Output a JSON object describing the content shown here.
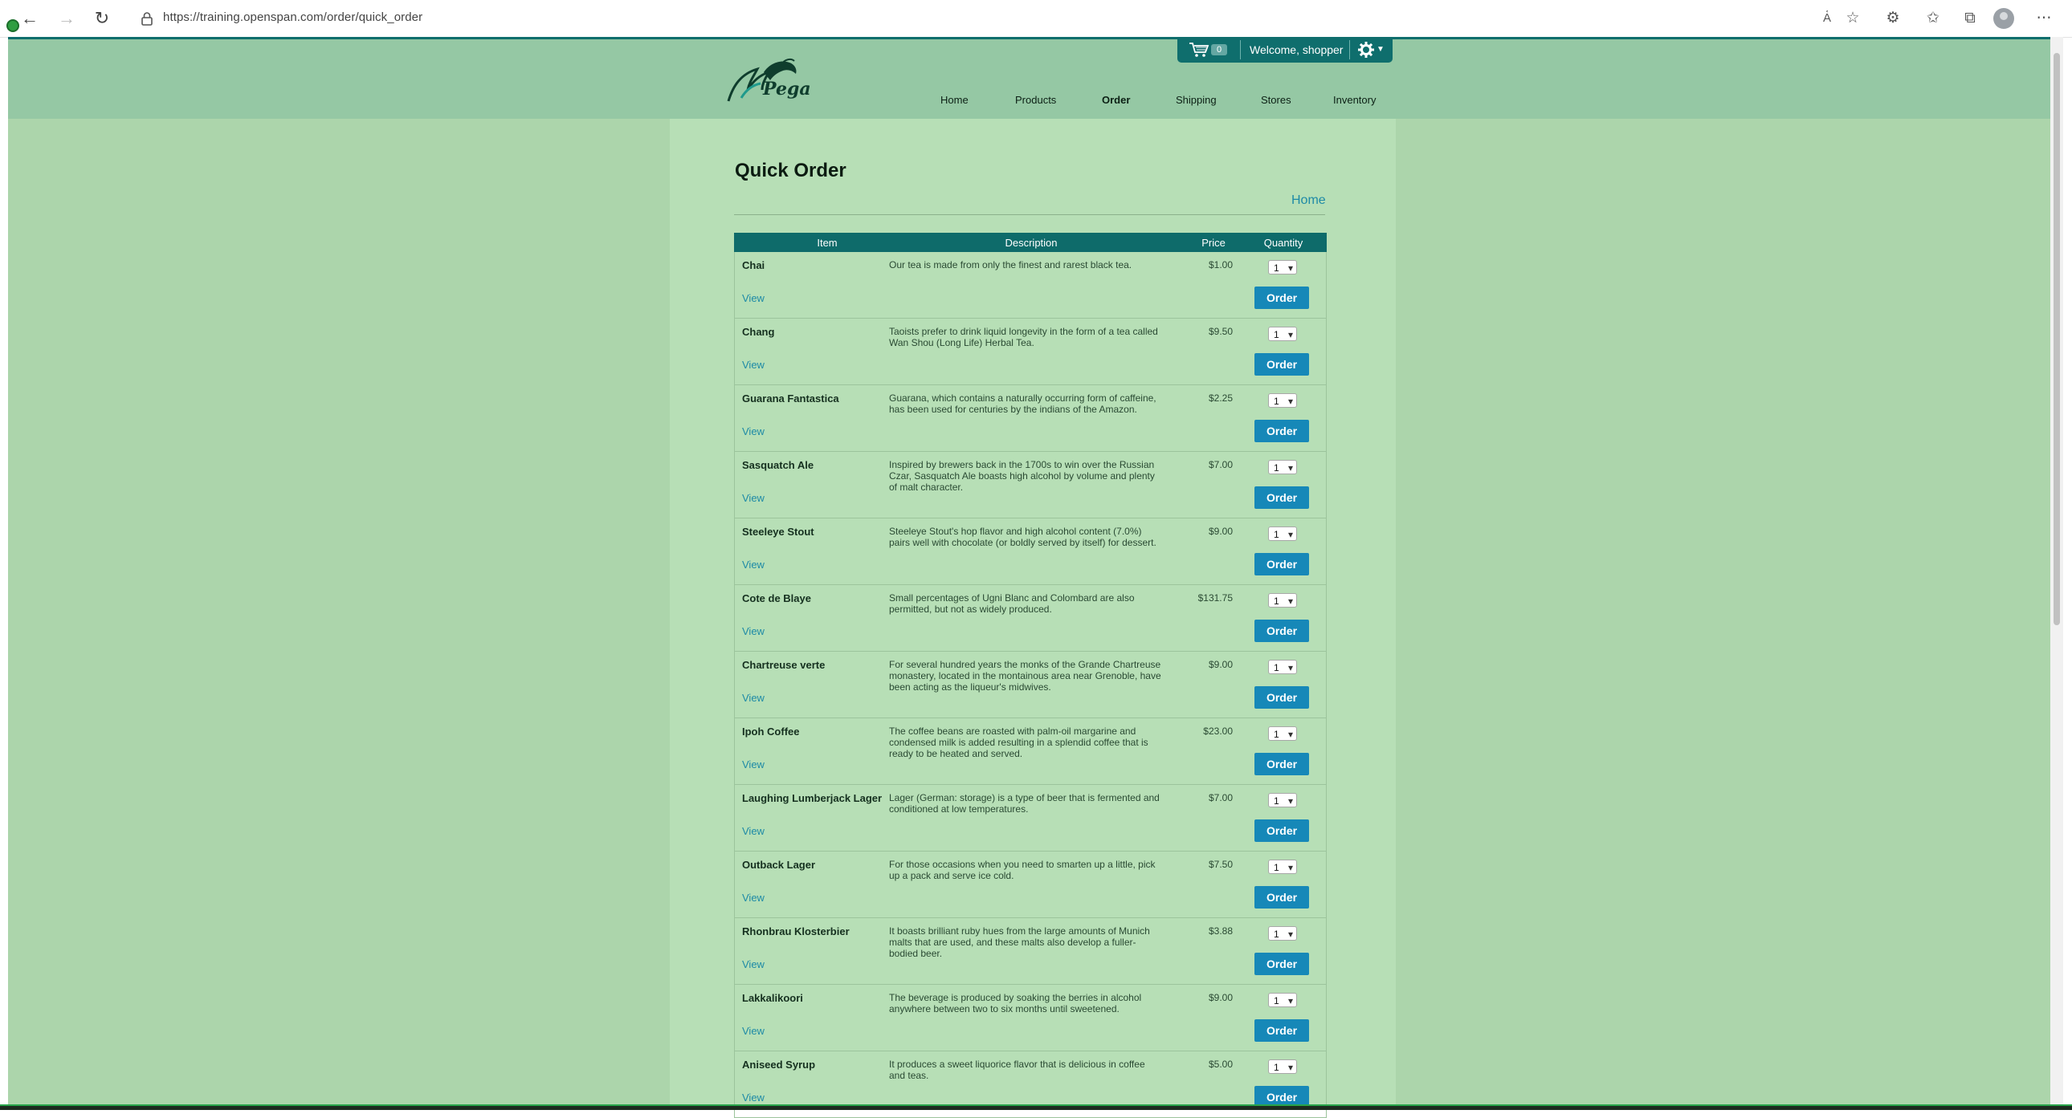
{
  "browser": {
    "url": "https://training.openspan.com/order/quick_order"
  },
  "site": {
    "logo_text": "Pega",
    "cart_count": "0",
    "welcome": "Welcome, shopper",
    "nav": [
      "Home",
      "Products",
      "Order",
      "Shipping",
      "Stores",
      "Inventory"
    ],
    "active_nav": "Order"
  },
  "page": {
    "title": "Quick Order",
    "home_link": "Home"
  },
  "table": {
    "headers": {
      "item": "Item",
      "description": "Description",
      "price": "Price",
      "quantity": "Quantity"
    },
    "view_label": "View",
    "order_label": "Order",
    "rows": [
      {
        "name": "Chai",
        "desc": "Our tea is made from only the finest and rarest black tea.",
        "price": "$1.00",
        "qty": "1"
      },
      {
        "name": "Chang",
        "desc": "Taoists prefer to drink liquid longevity in the form of a tea called Wan Shou (Long Life) Herbal Tea.",
        "price": "$9.50",
        "qty": "1"
      },
      {
        "name": "Guarana Fantastica",
        "desc": "Guarana, which contains a naturally occurring form of caffeine, has been used for centuries by the indians of the Amazon.",
        "price": "$2.25",
        "qty": "1"
      },
      {
        "name": "Sasquatch Ale",
        "desc": "Inspired by brewers back in the 1700s to win over the Russian Czar, Sasquatch Ale boasts high alcohol by volume and plenty of malt character.",
        "price": "$7.00",
        "qty": "1"
      },
      {
        "name": "Steeleye Stout",
        "desc": "Steeleye Stout's hop flavor and high alcohol content (7.0%) pairs well with chocolate (or boldly served by itself) for dessert.",
        "price": "$9.00",
        "qty": "1"
      },
      {
        "name": "Cote de Blaye",
        "desc": "Small percentages of Ugni Blanc and Colombard are also permitted, but not as widely produced.",
        "price": "$131.75",
        "qty": "1"
      },
      {
        "name": "Chartreuse verte",
        "desc": "For several hundred years the monks of the Grande Chartreuse monastery, located in the montainous area near Grenoble, have been acting as the liqueur's midwives.",
        "price": "$9.00",
        "qty": "1"
      },
      {
        "name": "Ipoh Coffee",
        "desc": "The coffee beans are roasted with palm-oil margarine and condensed milk is added resulting in a splendid coffee that is ready to be heated and served.",
        "price": "$23.00",
        "qty": "1"
      },
      {
        "name": "Laughing Lumberjack Lager",
        "desc": "Lager (German: storage) is a type of beer that is fermented and conditioned at low temperatures.",
        "price": "$7.00",
        "qty": "1"
      },
      {
        "name": "Outback Lager",
        "desc": "For those occasions when you need to smarten up a little, pick up a pack and serve ice cold.",
        "price": "$7.50",
        "qty": "1"
      },
      {
        "name": "Rhonbrau Klosterbier",
        "desc": "It boasts brilliant ruby hues from the large amounts of Munich malts that are used, and these malts also develop a fuller-bodied beer.",
        "price": "$3.88",
        "qty": "1"
      },
      {
        "name": "Lakkalikoori",
        "desc": "The beverage is produced by soaking the berries in alcohol anywhere between two to six months until sweetened.",
        "price": "$9.00",
        "qty": "1"
      },
      {
        "name": "Aniseed Syrup",
        "desc": "It produces a sweet liquorice flavor that is delicious in coffee and teas.",
        "price": "$5.00",
        "qty": "1"
      }
    ]
  }
}
